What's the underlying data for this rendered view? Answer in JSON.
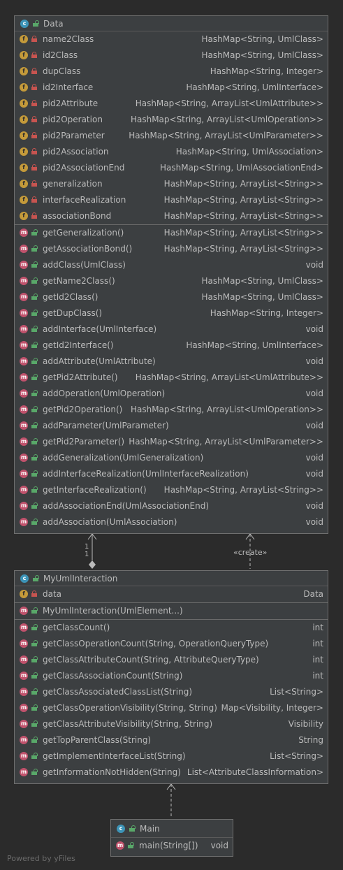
{
  "colors": {
    "background": "#2b2b2b",
    "panel": "#3c3f41",
    "class_badge": "#3d94b8",
    "field_badge": "#c49a3a",
    "method_badge": "#c0526c",
    "private_lock": "#c75450",
    "public_lock": "#59a869"
  },
  "classes": {
    "data": {
      "badge": "c",
      "name": "Data",
      "fields": [
        {
          "badge": "f",
          "name": "name2Class",
          "type": "HashMap<String, UmlClass>"
        },
        {
          "badge": "f",
          "name": "id2Class",
          "type": "HashMap<String, UmlClass>"
        },
        {
          "badge": "f",
          "name": "dupClass",
          "type": "HashMap<String, Integer>"
        },
        {
          "badge": "f",
          "name": "id2Interface",
          "type": "HashMap<String, UmlInterface>"
        },
        {
          "badge": "f",
          "name": "pid2Attribute",
          "type": "HashMap<String, ArrayList<UmlAttribute>>"
        },
        {
          "badge": "f",
          "name": "pid2Operation",
          "type": "HashMap<String, ArrayList<UmlOperation>>"
        },
        {
          "badge": "f",
          "name": "pid2Parameter",
          "type": "HashMap<String, ArrayList<UmlParameter>>"
        },
        {
          "badge": "f",
          "name": "pid2Association",
          "type": "HashMap<String, UmlAssociation>"
        },
        {
          "badge": "f",
          "name": "pid2AssociationEnd",
          "type": "HashMap<String, UmlAssociationEnd>"
        },
        {
          "badge": "f",
          "name": "generalization",
          "type": "HashMap<String, ArrayList<String>>"
        },
        {
          "badge": "f",
          "name": "interfaceRealization",
          "type": "HashMap<String, ArrayList<String>>"
        },
        {
          "badge": "f",
          "name": "associationBond",
          "type": "HashMap<String, ArrayList<String>>"
        }
      ],
      "methods": [
        {
          "badge": "m",
          "name": "getGeneralization()",
          "type": "HashMap<String, ArrayList<String>>"
        },
        {
          "badge": "m",
          "name": "getAssociationBond()",
          "type": "HashMap<String, ArrayList<String>>"
        },
        {
          "badge": "m",
          "name": "addClass(UmlClass)",
          "type": "void"
        },
        {
          "badge": "m",
          "name": "getName2Class()",
          "type": "HashMap<String, UmlClass>"
        },
        {
          "badge": "m",
          "name": "getId2Class()",
          "type": "HashMap<String, UmlClass>"
        },
        {
          "badge": "m",
          "name": "getDupClass()",
          "type": "HashMap<String, Integer>"
        },
        {
          "badge": "m",
          "name": "addInterface(UmlInterface)",
          "type": "void"
        },
        {
          "badge": "m",
          "name": "getId2Interface()",
          "type": "HashMap<String, UmlInterface>"
        },
        {
          "badge": "m",
          "name": "addAttribute(UmlAttribute)",
          "type": "void"
        },
        {
          "badge": "m",
          "name": "getPid2Attribute()",
          "type": "HashMap<String, ArrayList<UmlAttribute>>"
        },
        {
          "badge": "m",
          "name": "addOperation(UmlOperation)",
          "type": "void"
        },
        {
          "badge": "m",
          "name": "getPid2Operation()",
          "type": "HashMap<String, ArrayList<UmlOperation>>"
        },
        {
          "badge": "m",
          "name": "addParameter(UmlParameter)",
          "type": "void"
        },
        {
          "badge": "m",
          "name": "getPid2Parameter()",
          "type": "HashMap<String, ArrayList<UmlParameter>>"
        },
        {
          "badge": "m",
          "name": "addGeneralization(UmlGeneralization)",
          "type": "void"
        },
        {
          "badge": "m",
          "name": "addInterfaceRealization(UmlInterfaceRealization)",
          "type": "void"
        },
        {
          "badge": "m",
          "name": "getInterfaceRealization()",
          "type": "HashMap<String, ArrayList<String>>"
        },
        {
          "badge": "m",
          "name": "addAssociationEnd(UmlAssociationEnd)",
          "type": "void"
        },
        {
          "badge": "m",
          "name": "addAssociation(UmlAssociation)",
          "type": "void"
        }
      ]
    },
    "interaction": {
      "badge": "c",
      "name": "MyUmlInteraction",
      "fields": [
        {
          "badge": "f",
          "name": "data",
          "type": "Data"
        }
      ],
      "constructors": [
        {
          "badge": "m",
          "name": "MyUmlInteraction(UmlElement...)",
          "type": ""
        }
      ],
      "methods": [
        {
          "badge": "m",
          "name": "getClassCount()",
          "type": "int"
        },
        {
          "badge": "m",
          "name": "getClassOperationCount(String, OperationQueryType)",
          "type": "int"
        },
        {
          "badge": "m",
          "name": "getClassAttributeCount(String, AttributeQueryType)",
          "type": "int"
        },
        {
          "badge": "m",
          "name": "getClassAssociationCount(String)",
          "type": "int"
        },
        {
          "badge": "m",
          "name": "getClassAssociatedClassList(String)",
          "type": "List<String>"
        },
        {
          "badge": "m",
          "name": "getClassOperationVisibility(String, String)",
          "type": "Map<Visibility, Integer>"
        },
        {
          "badge": "m",
          "name": "getClassAttributeVisibility(String, String)",
          "type": "Visibility"
        },
        {
          "badge": "m",
          "name": "getTopParentClass(String)",
          "type": "String"
        },
        {
          "badge": "m",
          "name": "getImplementInterfaceList(String)",
          "type": "List<String>"
        },
        {
          "badge": "m",
          "name": "getInformationNotHidden(String)",
          "type": "List<AttributeClassInformation>"
        }
      ]
    },
    "main": {
      "badge": "c",
      "name": "Main",
      "methods": [
        {
          "badge": "m",
          "name": "main(String[])",
          "type": "void"
        }
      ]
    }
  },
  "edges": {
    "association_mult_top": "1",
    "association_mult_bottom": "1",
    "create_label": "«create»"
  },
  "footer": "Powered by yFiles"
}
